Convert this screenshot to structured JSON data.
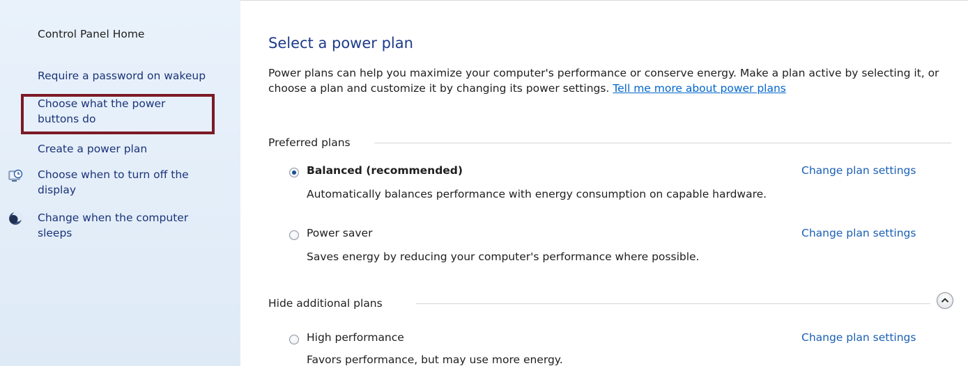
{
  "sidebar": {
    "home": "Control Panel Home",
    "items": [
      {
        "label": "Require a password on wakeup"
      },
      {
        "label_line1": "Choose what the power",
        "label_line2": "buttons do"
      },
      {
        "label": "Create a power plan"
      },
      {
        "label_line1": "Choose when to turn off the",
        "label_line2": "display",
        "icon": "clock-icon"
      },
      {
        "label_line1": "Change when the computer",
        "label_line2": "sleeps",
        "icon": "moon-icon"
      }
    ]
  },
  "main": {
    "title": "Select a power plan",
    "description": "Power plans can help you maximize your computer's performance or conserve energy. Make a plan active by selecting it, or choose a plan and customize it by changing its power settings. ",
    "help_link": "Tell me more about power plans",
    "preferred_header": "Preferred plans",
    "additional_header": "Hide additional plans",
    "plans": [
      {
        "name": "Balanced (recommended)",
        "description": "Automatically balances performance with energy consumption on capable hardware.",
        "link": "Change plan settings",
        "selected": true
      },
      {
        "name": "Power saver",
        "description": "Saves energy by reducing your computer's performance where possible.",
        "link": "Change plan settings",
        "selected": false
      },
      {
        "name": "High performance",
        "description": "Favors performance, but may use more energy.",
        "link": "Change plan settings",
        "selected": false
      }
    ]
  },
  "colors": {
    "highlight": "#7b1a26",
    "link": "#1a5fb4",
    "title": "#1e3b8a"
  }
}
